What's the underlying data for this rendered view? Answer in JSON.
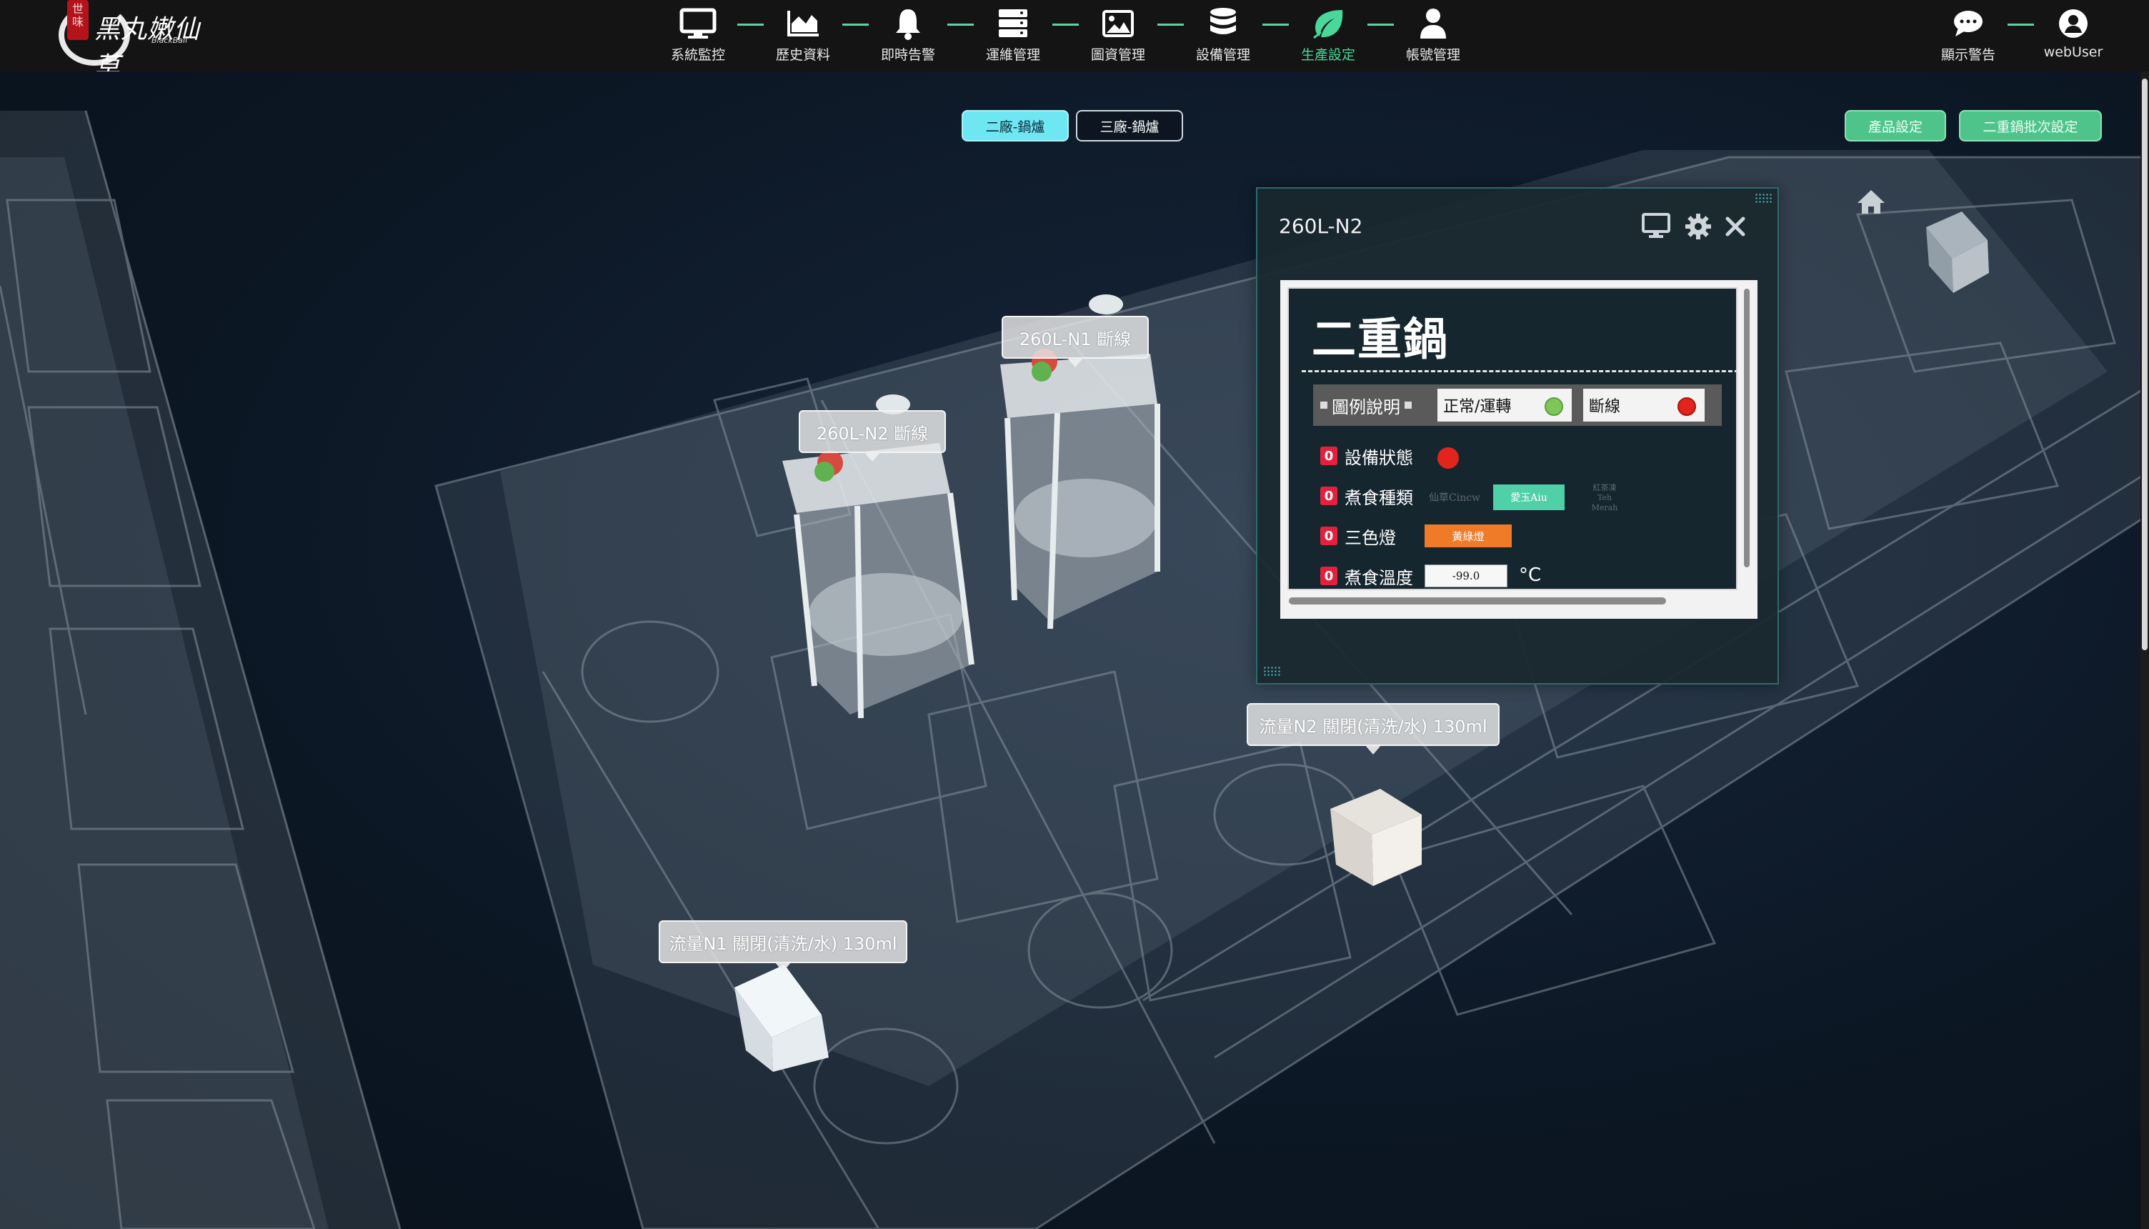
{
  "logo": {
    "brand": "黑丸嫩仙草",
    "sub": "BlackBall",
    "seal": "世 味"
  },
  "nav": {
    "items": [
      {
        "label": "系統監控",
        "icon": "monitor-icon",
        "active": false
      },
      {
        "label": "歷史資料",
        "icon": "area-chart-icon",
        "active": false
      },
      {
        "label": "即時告警",
        "icon": "bell-icon",
        "active": false
      },
      {
        "label": "運維管理",
        "icon": "server-icon",
        "active": false
      },
      {
        "label": "圖資管理",
        "icon": "image-icon",
        "active": false
      },
      {
        "label": "設備管理",
        "icon": "database-icon",
        "active": false
      },
      {
        "label": "生產設定",
        "icon": "leaf-icon",
        "active": true
      },
      {
        "label": "帳號管理",
        "icon": "user-icon",
        "active": false
      }
    ],
    "right": [
      {
        "label": "顯示警告",
        "icon": "chat-icon"
      },
      {
        "label": "webUser",
        "icon": "user-circle-icon"
      }
    ]
  },
  "tabs": {
    "plant2": "二廠-鍋爐",
    "plant3": "三廠-鍋爐"
  },
  "actions": {
    "product": "產品設定",
    "batch": "二重鍋批次設定"
  },
  "tags": {
    "n1": "260L-N1 斷線",
    "n2": "260L-N2 斷線",
    "flow_n2": "流量N2  關閉(清洗/水) 130ml",
    "flow_n1": "流量N1  關閉(清洗/水) 130ml"
  },
  "dialog": {
    "title": "260L-N2",
    "board_title": "二重鍋",
    "legend": {
      "label": "圖例說明",
      "normal": "正常/運轉",
      "offline": "斷線"
    },
    "rows": {
      "status": {
        "badge": "0",
        "label": "設備狀態"
      },
      "food": {
        "badge": "0",
        "label": "煮食種類"
      },
      "light": {
        "badge": "0",
        "label": "三色燈"
      },
      "temp": {
        "badge": "0",
        "label": "煮食溫度"
      }
    },
    "food_options": {
      "opt1": "仙草Cincw",
      "opt2": "愛玉Aiu",
      "opt3a": "紅茶凍",
      "opt3b": "Teh Merah"
    },
    "light_value": "黃綠燈",
    "temp_value": "-99.0",
    "temp_unit": "°C"
  },
  "colors": {
    "accent": "#5fd2a4",
    "tab_active": "#6ee7f2",
    "action_green": "#4ec48b",
    "status_red": "#e1241c",
    "status_green": "#7fc55a",
    "badge_red": "#e3213f",
    "light_orange": "#ef7a28"
  }
}
